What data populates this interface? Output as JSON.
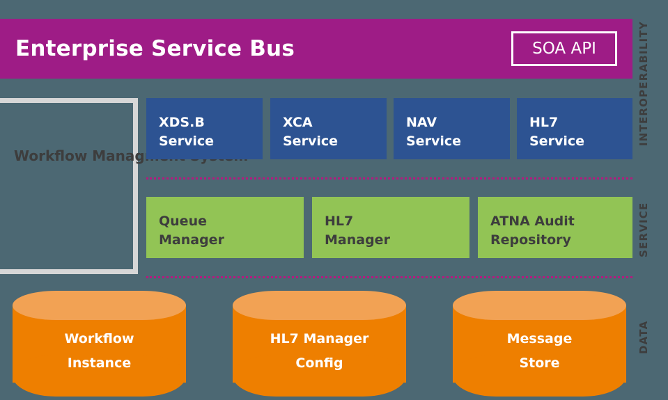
{
  "header": {
    "title": "Enterprise Service Bus",
    "api_badge": "SOA API",
    "bar_color": "#9e1c86"
  },
  "workflow_panel": {
    "label": "Workflow\nManagment\nSystem",
    "border_color": "#d7d7d7",
    "fill_color": "#4c6873"
  },
  "interoperability_layer": {
    "color": "#2d5392",
    "services": [
      {
        "label": "XDS.B\nService"
      },
      {
        "label": "XCA\nService"
      },
      {
        "label": "NAV\nService"
      },
      {
        "label": "HL7\nService"
      }
    ]
  },
  "service_layer": {
    "color": "#92c455",
    "services": [
      {
        "label": "Queue\nManager"
      },
      {
        "label": "HL7\nManager"
      },
      {
        "label": "ATNA Audit\nRepository"
      }
    ]
  },
  "data_layer": {
    "color": "#ee7f00",
    "top_color": "#f2a254",
    "stores": [
      {
        "label": "Workflow\nInstance"
      },
      {
        "label": "HL7 Manager\nConfig"
      },
      {
        "label": "Message\nStore"
      }
    ]
  },
  "bands": [
    {
      "label": "INTEROPERABILITY"
    },
    {
      "label": "SERVICE"
    },
    {
      "label": "DATA"
    }
  ],
  "separators": {
    "color": "#b5197f"
  },
  "background_color": "#4c6873"
}
